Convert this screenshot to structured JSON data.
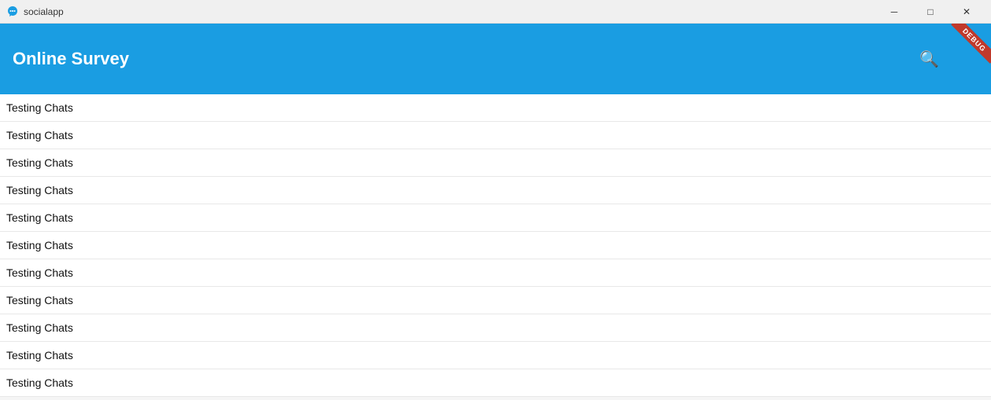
{
  "titlebar": {
    "app_name": "socialapp",
    "minimize_label": "─",
    "maximize_label": "□",
    "close_label": "✕"
  },
  "header": {
    "title": "Online Survey",
    "search_icon": "🔍",
    "debug_label": "DEBUG"
  },
  "chat_items": [
    {
      "label": "Testing Chats"
    },
    {
      "label": "Testing Chats"
    },
    {
      "label": "Testing Chats"
    },
    {
      "label": "Testing Chats"
    },
    {
      "label": "Testing Chats"
    },
    {
      "label": "Testing Chats"
    },
    {
      "label": "Testing Chats"
    },
    {
      "label": "Testing Chats"
    },
    {
      "label": "Testing Chats"
    },
    {
      "label": "Testing Chats"
    },
    {
      "label": "Testing Chats"
    }
  ],
  "colors": {
    "header_bg": "#1a9de2",
    "debug_ribbon": "#c0392b"
  }
}
